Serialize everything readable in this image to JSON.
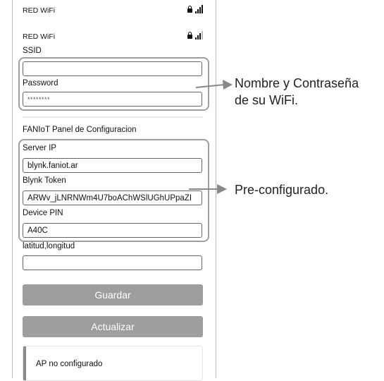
{
  "networks": [
    {
      "name": "RED WiFi",
      "secured": true
    },
    {
      "name": "RED WiFi",
      "secured": true
    }
  ],
  "wifi_form": {
    "ssid_label": "SSID",
    "ssid_value": "",
    "password_label": "Password",
    "password_value": "********"
  },
  "panel": {
    "heading": "FANIoT Panel de Configuracion",
    "server_ip_label": "Server IP",
    "server_ip_value": "blynk.faniot.ar",
    "token_label": "Blynk Token",
    "token_value": "ARWv_jLNRNWm4U7boAChWSlUGhUPpaZI",
    "pin_label": "Device PIN",
    "pin_value": "A40C",
    "latlon_label": "latitud,longitud",
    "latlon_value": ""
  },
  "buttons": {
    "save": "Guardar",
    "update": "Actualizar"
  },
  "status": {
    "message": "AP no configurado"
  },
  "annotations": {
    "wifi_line1": "Nombre y Contraseña",
    "wifi_line2": "de su WiFi.",
    "preconfig": "Pre-configurado."
  },
  "colors": {
    "button_bg": "#9e9e9e",
    "group_border": "#9e9e9e",
    "accent": "#8a8a8a"
  }
}
